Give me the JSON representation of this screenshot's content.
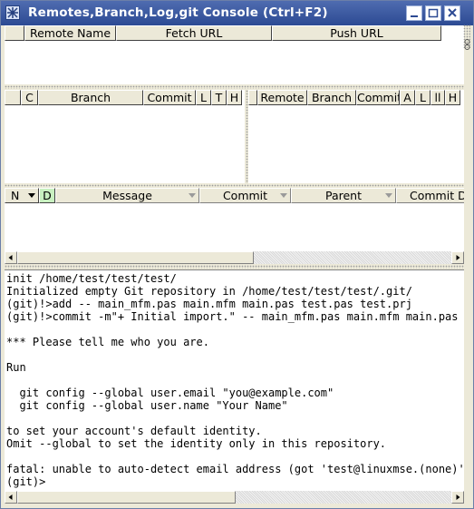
{
  "window": {
    "title": "Remotes,Branch,Log,git Console (Ctrl+F2)",
    "app_icon": "app-icon",
    "buttons": [
      "minimize-icon",
      "maximize-icon",
      "close-icon"
    ]
  },
  "remotes": {
    "columns": [
      "",
      "Remote Name",
      "Fetch URL",
      "Push URL"
    ]
  },
  "branches_local": {
    "columns": [
      "",
      "C",
      "Branch",
      "Commit",
      "L",
      "T",
      "H"
    ]
  },
  "branches_remote": {
    "columns": [
      "",
      "Remote",
      "Branch",
      "Commit",
      "A",
      "L",
      "ll",
      "H"
    ]
  },
  "log": {
    "columns": [
      "N",
      "D",
      "Message",
      "Commit",
      "Parent",
      "Commit D"
    ]
  },
  "console": {
    "lines": [
      "init /home/test/test/test/",
      "Initialized empty Git repository in /home/test/test/test/.git/",
      "(git)!>add -- main_mfm.pas main.mfm main.pas test.pas test.prj",
      "(git)!>commit -m\"+ Initial import.\" -- main_mfm.pas main.mfm main.pas te",
      "",
      "*** Please tell me who you are.",
      "",
      "Run",
      "",
      "  git config --global user.email \"you@example.com\"",
      "  git config --global user.name \"Your Name\"",
      "",
      "to set your account's default identity.",
      "Omit --global to set the identity only in this repository.",
      "",
      "fatal: unable to auto-detect email address (got 'test@linuxmse.(none)')",
      "(git)>"
    ]
  },
  "colors": {
    "title_bar": "#3a5aa0",
    "frame": "#ece9d8",
    "d_column_highlight": "#c8f0c0"
  }
}
